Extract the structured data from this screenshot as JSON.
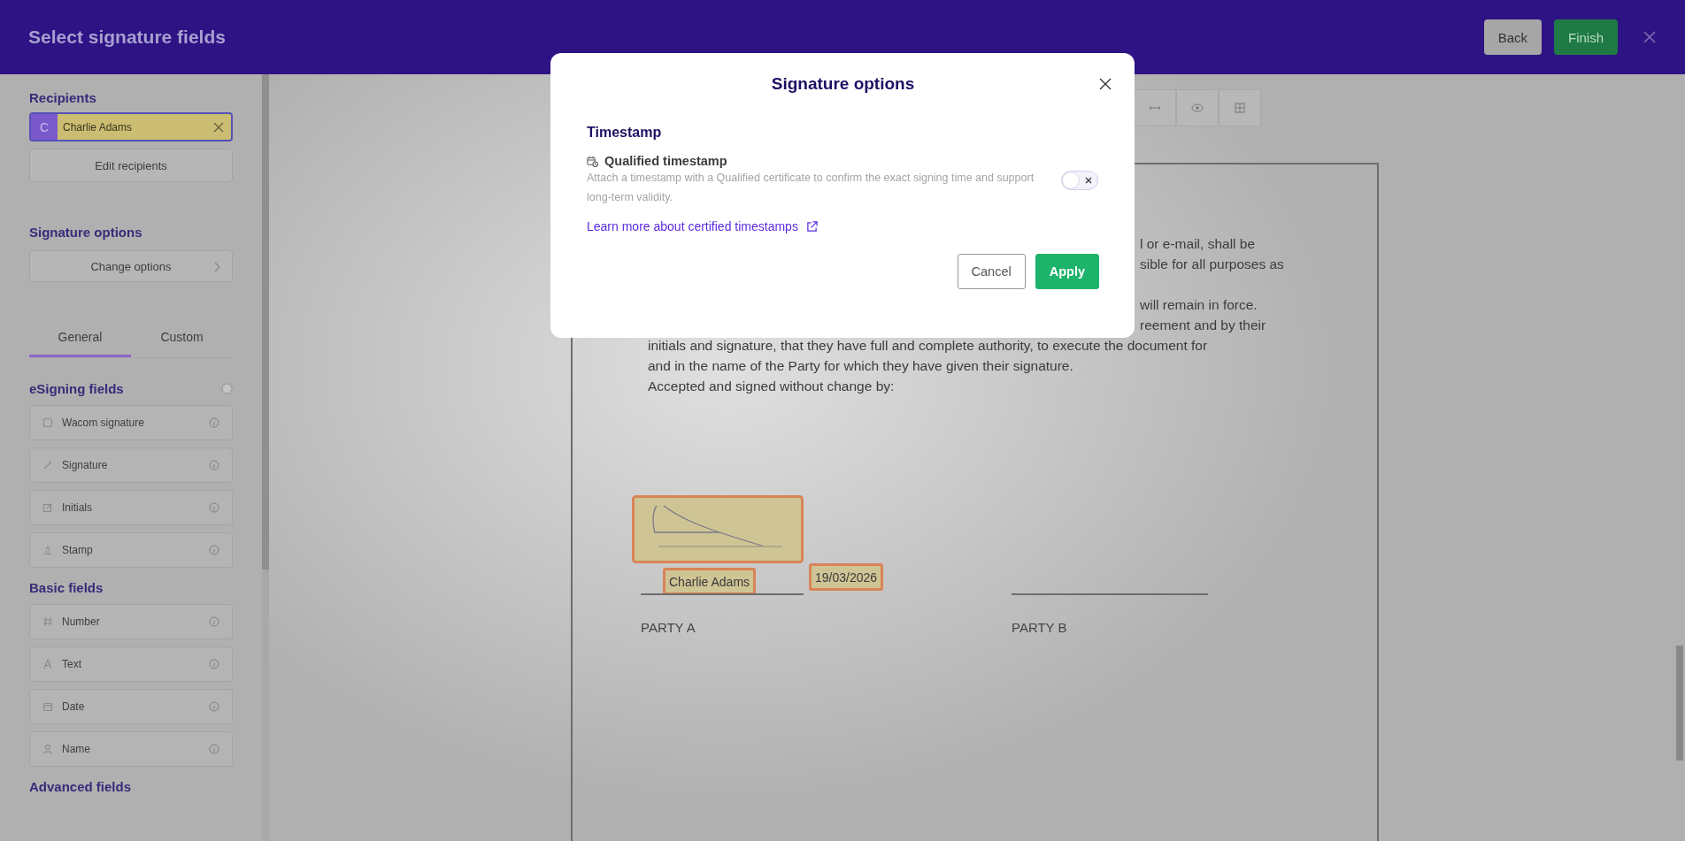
{
  "header": {
    "title": "Select signature fields",
    "buttons": [
      {
        "label": "Back",
        "kind": "secondary"
      },
      {
        "label": "Finish",
        "kind": "primary"
      }
    ]
  },
  "sidebar": {
    "recipients": {
      "heading": "Recipients",
      "items": [
        {
          "initial": "C",
          "name": "Charlie Adams"
        }
      ],
      "button": "Edit recipients"
    },
    "signature_options": {
      "heading": "Signature options",
      "button": "Change options"
    },
    "tabs": [
      {
        "label": "General",
        "selected": true
      },
      {
        "label": "Custom",
        "selected": false
      }
    ],
    "field_groups": [
      {
        "heading": "eSigning fields",
        "items": [
          {
            "label": "Wacom signature",
            "kind": "wacom"
          },
          {
            "label": "Signature",
            "kind": "pen"
          },
          {
            "label": "Initials",
            "kind": "initials"
          },
          {
            "label": "Stamp",
            "kind": "stamp"
          }
        ]
      },
      {
        "heading": "Basic fields",
        "items": [
          {
            "label": "Number",
            "kind": "number"
          },
          {
            "label": "Text",
            "kind": "text"
          },
          {
            "label": "Date",
            "kind": "date"
          },
          {
            "label": "Name",
            "kind": "name"
          }
        ]
      },
      {
        "heading": "Advanced fields"
      }
    ]
  },
  "document": {
    "cut_paragraphs": [
      [
        "l or e-mail, shall be",
        "sible for all purposes as"
      ],
      [
        "will remain in force.",
        "reement and by their"
      ]
    ],
    "lines": [
      "initials and signature, that they have full and complete authority, to execute the document for",
      "and in the name of the Party for which they have given their signature.",
      "Accepted and signed without change by:"
    ],
    "name_field": "Charlie Adams",
    "date_field": "19/03/2026",
    "parties": [
      "PARTY A",
      "PARTY B"
    ]
  },
  "modal": {
    "title": "Signature options",
    "section": "Timestamp",
    "option": {
      "label": "Qualified timestamp",
      "description": "Attach a timestamp with a Qualified certificate to confirm the exact signing time and support long-term validity.",
      "on": false
    },
    "link": "Learn more about certified timestamps",
    "buttons": [
      {
        "label": "Cancel",
        "kind": "secondary"
      },
      {
        "label": "Apply",
        "kind": "primary"
      }
    ]
  }
}
